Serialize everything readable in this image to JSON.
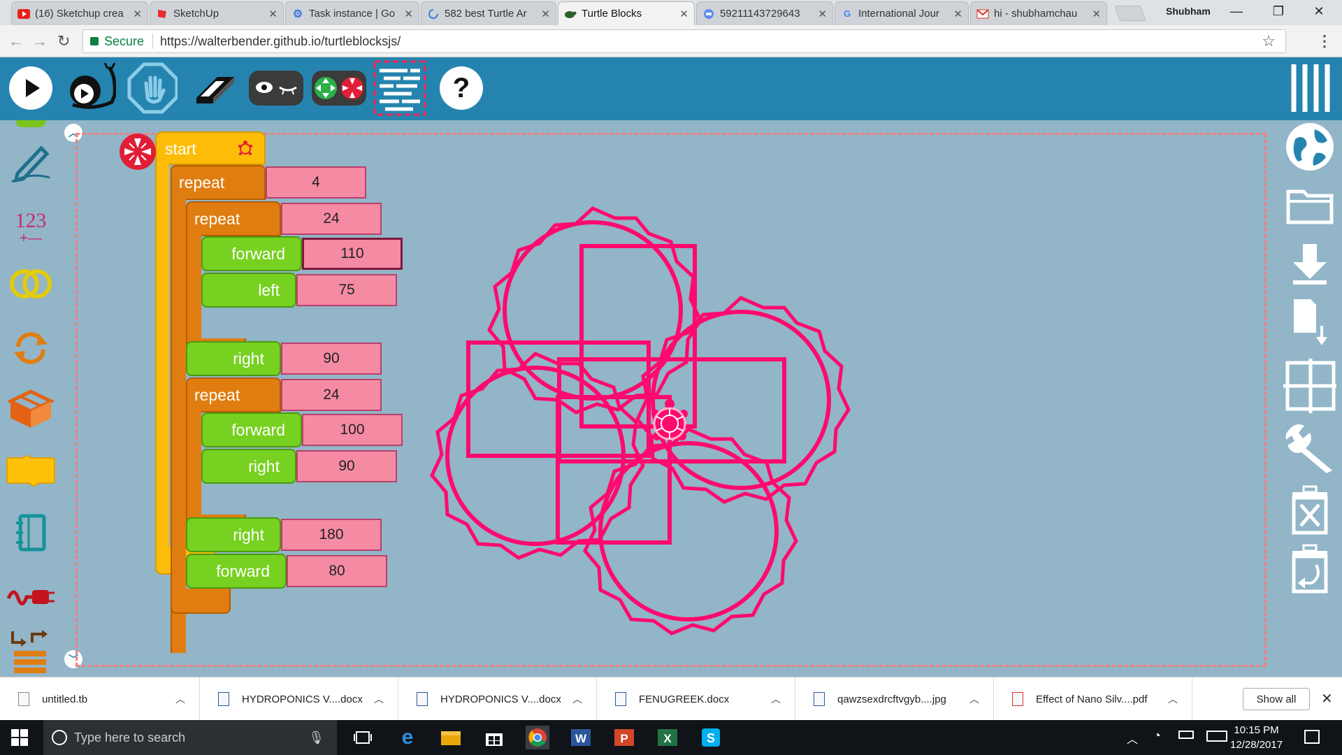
{
  "browser": {
    "tabs": [
      {
        "title": "(16) Sketchup crea",
        "icon": "youtube-icon"
      },
      {
        "title": "SketchUp",
        "icon": "sketchup-icon"
      },
      {
        "title": "Task instance | Go",
        "icon": "gear-icon"
      },
      {
        "title": "582 best Turtle Ar",
        "icon": "loading-icon"
      },
      {
        "title": "Turtle Blocks",
        "icon": "turtle-icon",
        "active": true
      },
      {
        "title": "59211143729643",
        "icon": "doc-icon"
      },
      {
        "title": "International Jour",
        "icon": "google-icon"
      },
      {
        "title": "hi - shubhamchau",
        "icon": "gmail-icon"
      }
    ],
    "profile": "Shubham",
    "secure_label": "Secure",
    "url": "https://walterbender.github.io/turtleblocksjs/"
  },
  "toolbar": {
    "buttons": [
      "run",
      "run-slow",
      "stop",
      "clear",
      "hide-blocks",
      "collapse-blocks",
      "home",
      "help"
    ]
  },
  "palette": {
    "items": [
      "pen",
      "number",
      "boolean",
      "flow",
      "action",
      "box",
      "media",
      "sensors",
      "extras"
    ],
    "number_label": "123",
    "number_ops": "+—"
  },
  "program": {
    "start_label": "start",
    "blocks": [
      {
        "label": "repeat",
        "value": "4"
      },
      {
        "label": "repeat",
        "value": "24"
      },
      {
        "label": "forward",
        "value": "110"
      },
      {
        "label": "left",
        "value": "75"
      },
      {
        "label": "right",
        "value": "90"
      },
      {
        "label": "repeat",
        "value": "24"
      },
      {
        "label": "forward",
        "value": "100"
      },
      {
        "label": "right",
        "value": "90"
      },
      {
        "label": "right",
        "value": "180"
      },
      {
        "label": "forward",
        "value": "80"
      }
    ]
  },
  "right_toolbar": {
    "buttons": [
      "planet",
      "open",
      "save",
      "save-as",
      "grid",
      "settings",
      "delete",
      "restore"
    ]
  },
  "colors": {
    "drawing": "#ff0a6e",
    "toolbar": "#2584af",
    "canvas": "#92b5c8",
    "flow_block": "#e07d10",
    "move_block": "#77d121",
    "start_block": "#fcbc07",
    "arg": "#f58ba3"
  },
  "downloads": {
    "items": [
      "untitled.tb",
      "HYDROPONICS V....docx",
      "HYDROPONICS V....docx",
      "FENUGREEK.docx",
      "qawzsexdrcftvgyb....jpg",
      "Effect of Nano Silv....pdf"
    ],
    "show_all": "Show all"
  },
  "taskbar": {
    "search_placeholder": "Type here to search",
    "time": "10:15 PM",
    "date": "12/28/2017"
  }
}
